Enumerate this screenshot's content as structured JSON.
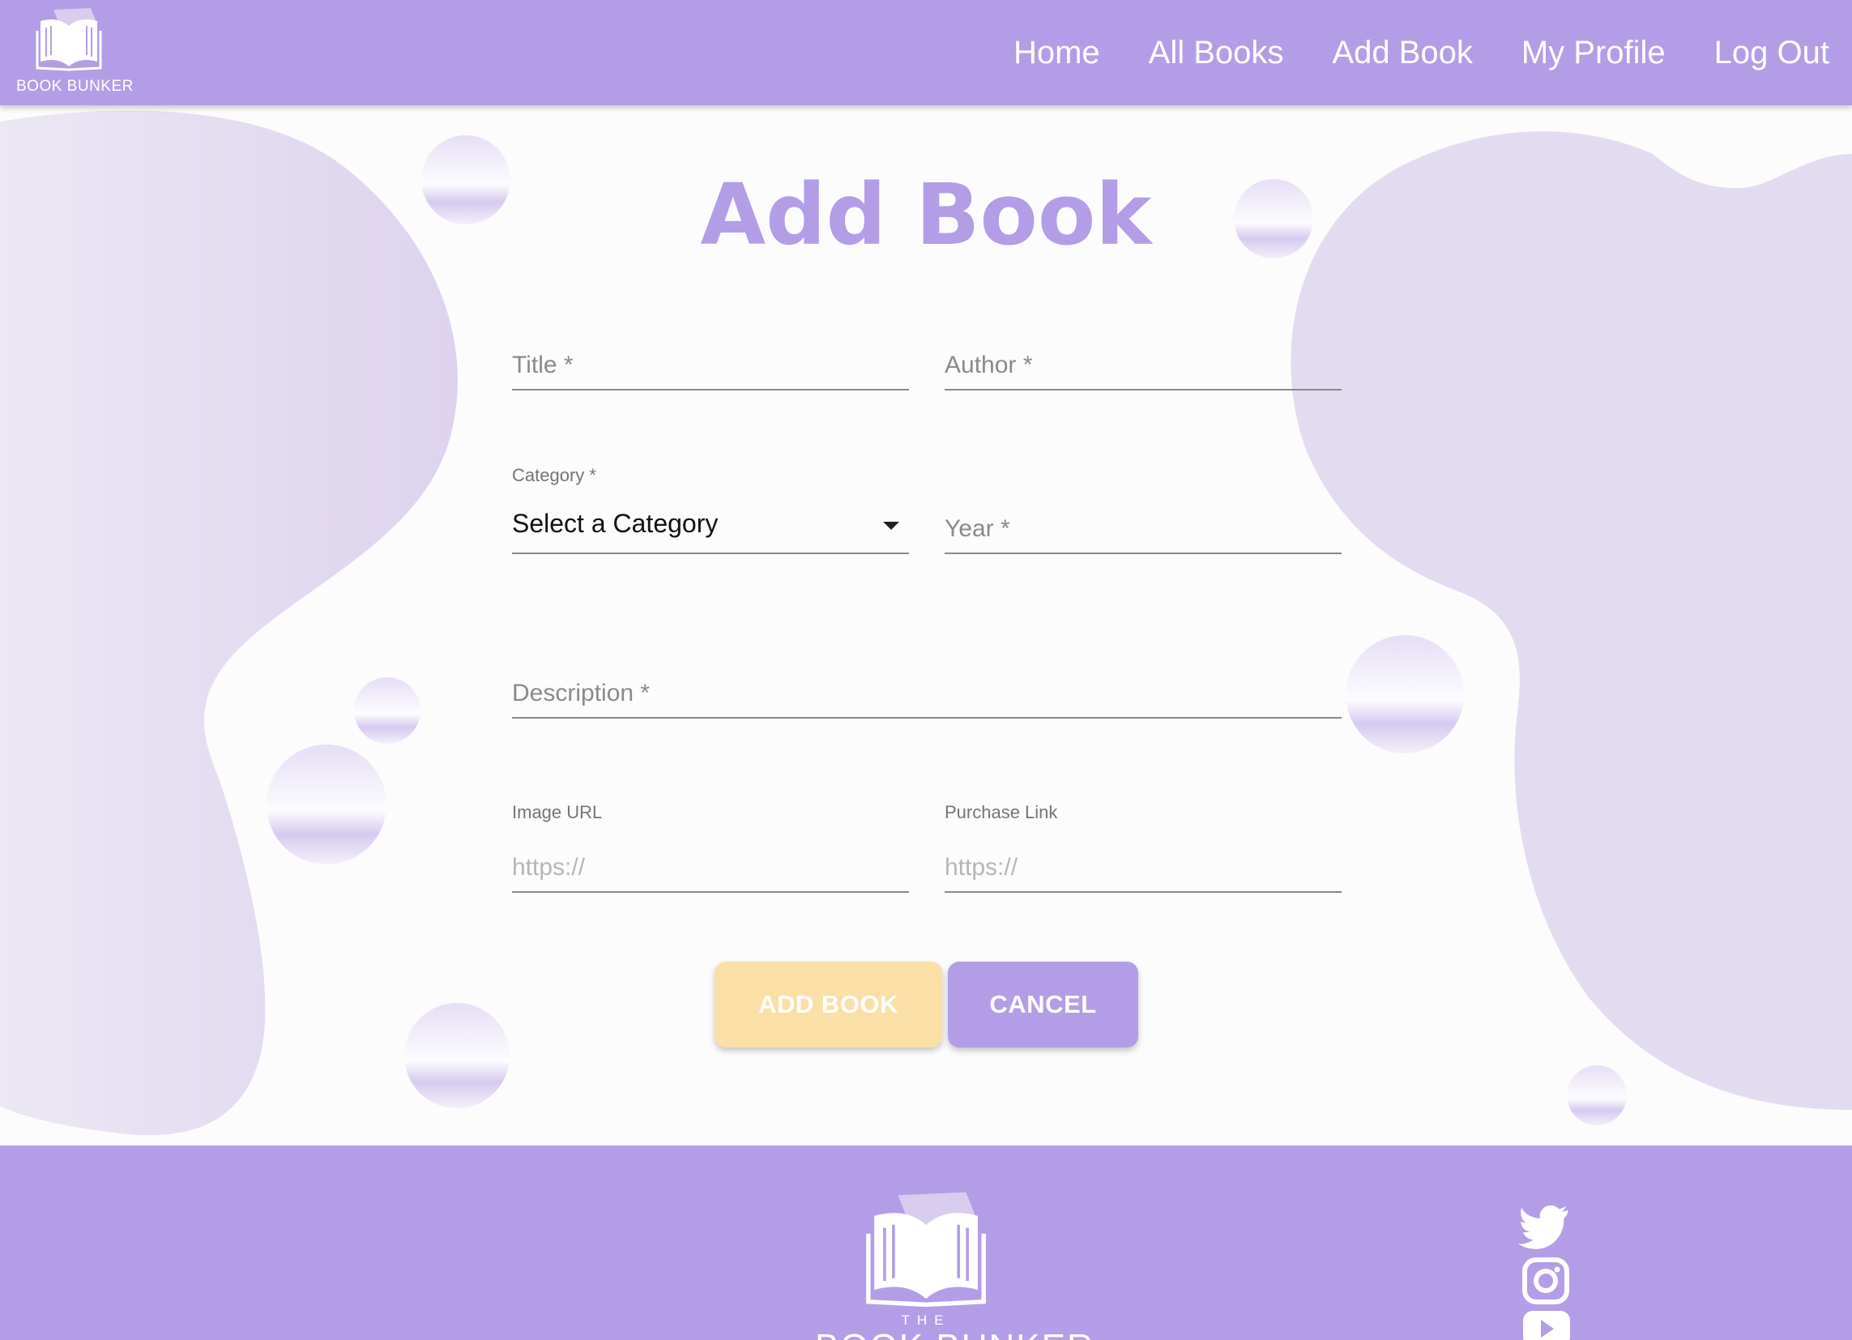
{
  "app": {
    "logo_text": "BOOK BUNKER",
    "logo_small": "THE"
  },
  "nav": {
    "links": [
      "Home",
      "All Books",
      "Add Book",
      "My Profile",
      "Log Out"
    ]
  },
  "form": {
    "title": "Add Book",
    "title_field": {
      "placeholder": "Title *",
      "value": ""
    },
    "author_field": {
      "placeholder": "Author *",
      "value": ""
    },
    "category_field": {
      "label": "Category *",
      "selected": "Select a Category"
    },
    "year_field": {
      "placeholder": "Year *",
      "value": ""
    },
    "description_field": {
      "placeholder": "Description *",
      "value": ""
    },
    "image_url_field": {
      "label": "Image URL",
      "placeholder": "https://"
    },
    "purchase_link_field": {
      "label": "Purchase Link",
      "placeholder": "https://"
    },
    "add_button": "ADD BOOK",
    "cancel_button": "CANCEL"
  },
  "footer": {
    "logo_small": "THE",
    "logo_text": "BOOK BUNKER",
    "social_icons": [
      "twitter-icon",
      "instagram-icon",
      "youtube-icon"
    ]
  },
  "colors": {
    "primary": "#b39de6",
    "accent": "#fadfa7",
    "background": "#fcfcfd",
    "blob": "#e3dcf0"
  }
}
